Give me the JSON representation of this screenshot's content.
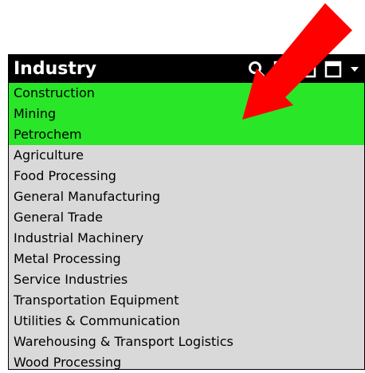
{
  "panel": {
    "title": "Industry",
    "icons": [
      "search-icon",
      "comment-icon",
      "square-icon",
      "window-icon",
      "dropdown-arrow-icon"
    ]
  },
  "items": [
    {
      "label": "Construction",
      "selected": true
    },
    {
      "label": "Mining",
      "selected": true
    },
    {
      "label": "Petrochem",
      "selected": true
    },
    {
      "label": "Agriculture",
      "selected": false
    },
    {
      "label": "Food Processing",
      "selected": false
    },
    {
      "label": "General Manufacturing",
      "selected": false
    },
    {
      "label": "General Trade",
      "selected": false
    },
    {
      "label": "Industrial Machinery",
      "selected": false
    },
    {
      "label": "Metal Processing",
      "selected": false
    },
    {
      "label": "Service Industries",
      "selected": false
    },
    {
      "label": "Transportation Equipment",
      "selected": false
    },
    {
      "label": "Utilities & Communication",
      "selected": false
    },
    {
      "label": "Warehousing & Transport Logistics",
      "selected": false
    },
    {
      "label": "Wood Processing",
      "selected": false
    }
  ],
  "colors": {
    "selected_bg": "#29e629",
    "list_bg": "#d9d9d9",
    "header_bg": "#000000",
    "arrow": "#ff0000"
  }
}
